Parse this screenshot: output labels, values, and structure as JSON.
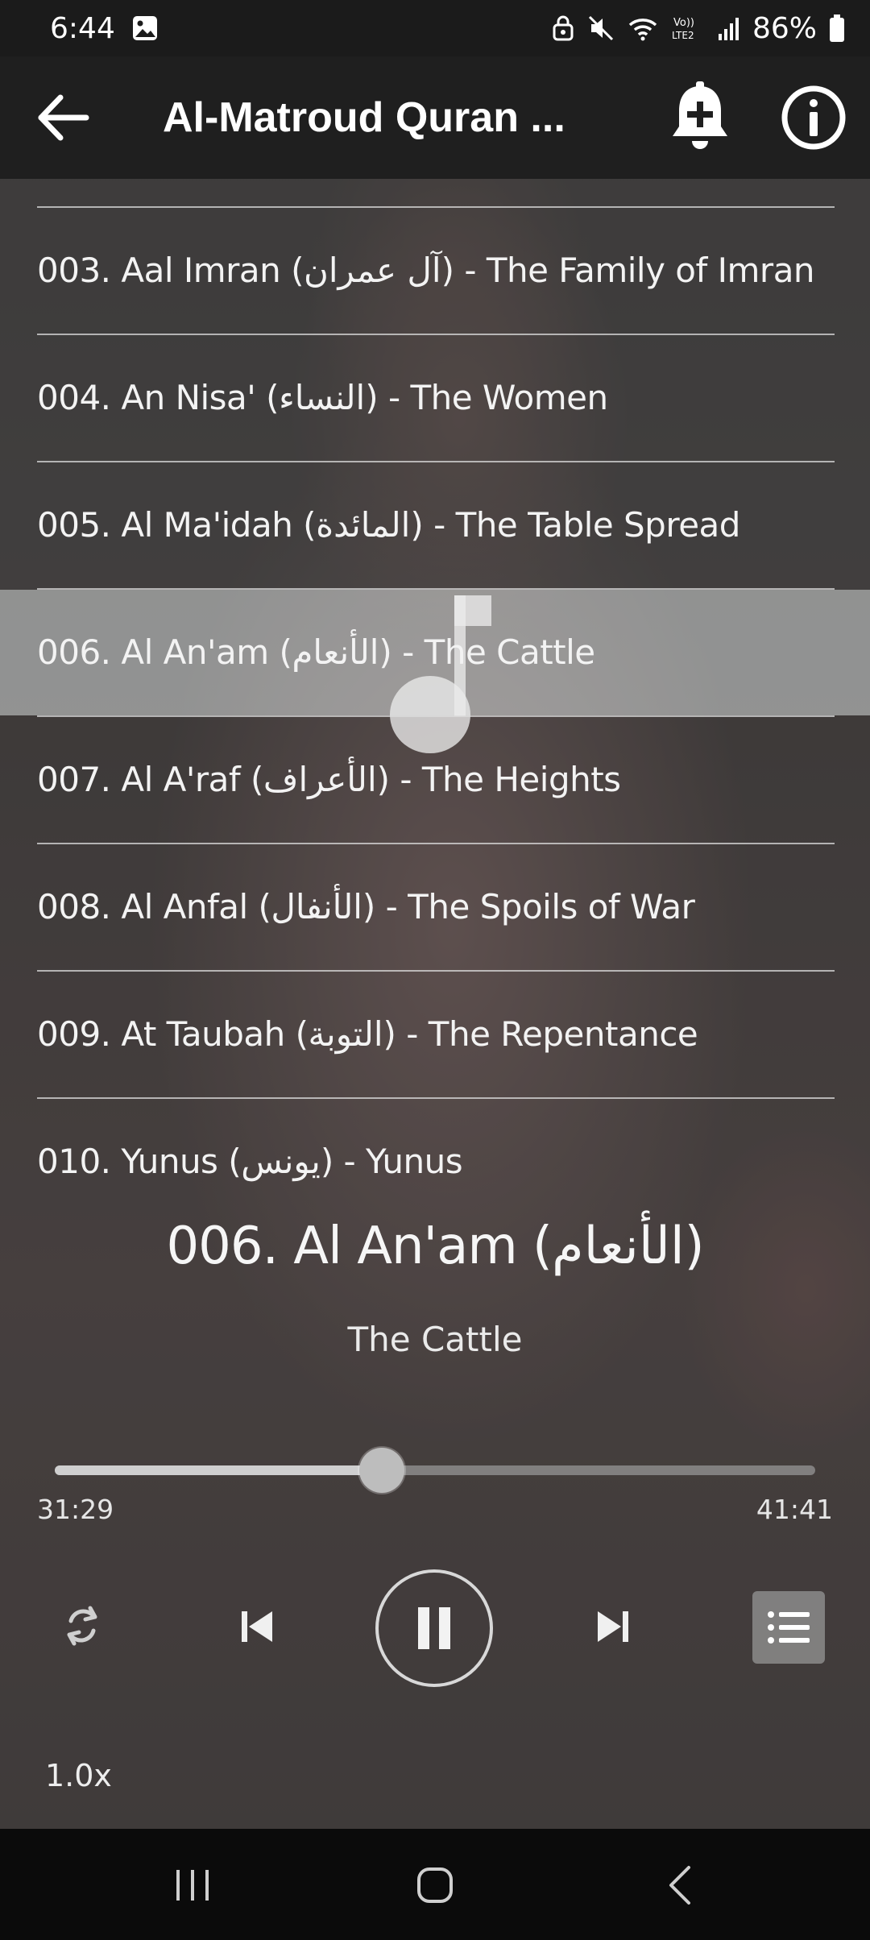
{
  "status_bar": {
    "time": "6:44",
    "battery": "86%",
    "icons": [
      "gallery-icon",
      "lock-icon",
      "mute-icon",
      "wifi-icon",
      "volte-icon",
      "signal-icon",
      "battery-icon"
    ]
  },
  "app_bar": {
    "title": "Al-Matroud Quran ...",
    "back_icon": "arrow-left-icon",
    "bell_icon": "bell-plus-icon",
    "info_icon": "info-icon"
  },
  "tracks": [
    {
      "label": "003. Aal Imran (آل عمران) - The Family of Imran",
      "active": false
    },
    {
      "label": "004. An Nisa' (النساء) - The Women",
      "active": false
    },
    {
      "label": "005. Al Ma'idah (المائدة) - The Table Spread",
      "active": false
    },
    {
      "label": "006. Al An'am (الأنعام) - The Cattle",
      "active": true
    },
    {
      "label": "007. Al A'raf (الأعراف) - The Heights",
      "active": false
    },
    {
      "label": "008. Al Anfal (الأنفال) - The Spoils of War",
      "active": false
    },
    {
      "label": "009. At Taubah (التوبة) - The Repentance",
      "active": false
    },
    {
      "label": "010. Yunus (يونس) - Yunus",
      "active": false
    }
  ],
  "now_playing": {
    "title": "006. Al An'am (الأنعام)",
    "subtitle": "The Cattle",
    "elapsed": "31:29",
    "total": "41:41",
    "progress": 0.43,
    "speed": "1.0x"
  },
  "colors": {
    "app_bar": "#1f1f1f",
    "status_bar": "#1b1b1b",
    "highlight": "#bec3c4",
    "text": "#f2f2f2"
  }
}
